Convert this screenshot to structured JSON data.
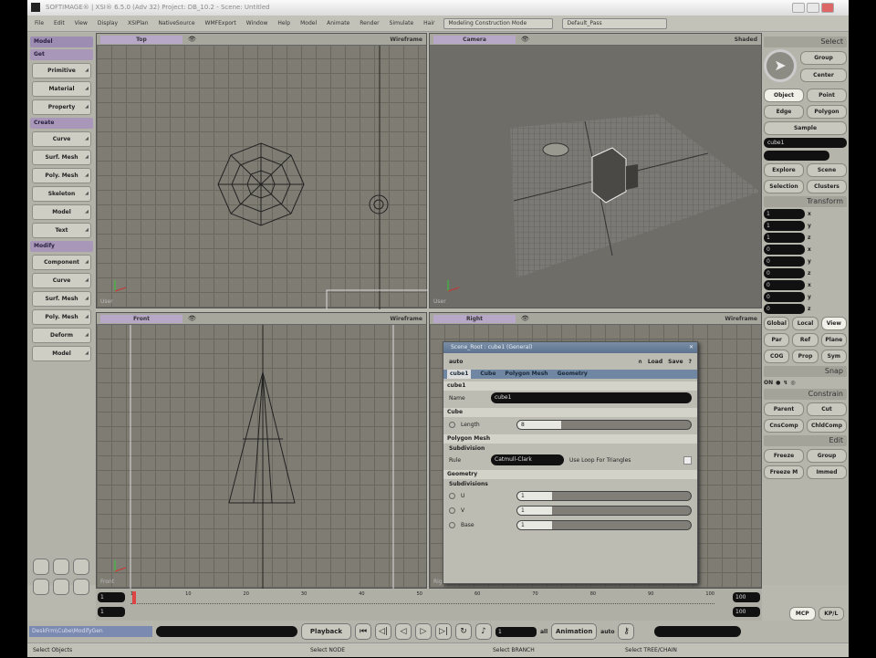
{
  "window": {
    "title": "SOFTIMAGE® | XSI® 6.5.0 (Adv 32) Project: DB_10.2 - Scene: Untitled"
  },
  "menu": [
    "File",
    "Edit",
    "View",
    "Display",
    "XSIPlan",
    "NativeSource",
    "WMFExport",
    "Window",
    "Help",
    "Model",
    "Animate",
    "Render",
    "Simulate",
    "Hair"
  ],
  "toolbar": {
    "mode": "Modeling Construction Mode",
    "pass": "Default_Pass"
  },
  "left_panel": {
    "selector": "Model",
    "sections": [
      {
        "title": "Get",
        "items": [
          "Primitive",
          "Material",
          "Property"
        ]
      },
      {
        "title": "Create",
        "items": [
          "Curve",
          "Surf. Mesh",
          "Poly. Mesh",
          "Skeleton",
          "Model",
          "Text"
        ]
      },
      {
        "title": "Modify",
        "items": [
          "Component",
          "Curve",
          "Surf. Mesh",
          "Poly. Mesh",
          "Deform",
          "Model"
        ]
      }
    ]
  },
  "viewports": [
    {
      "camera": "Top",
      "mode": "Wireframe",
      "corner": "User"
    },
    {
      "camera": "Camera",
      "mode": "Shaded",
      "corner": "User"
    },
    {
      "camera": "Front",
      "mode": "Wireframe",
      "corner": "Front"
    },
    {
      "camera": "Right",
      "mode": "Wireframe",
      "corner": "Right"
    }
  ],
  "right_panel": {
    "select_title": "Select",
    "select_buttons": [
      "Group",
      "Center"
    ],
    "filter_buttons": [
      [
        "Object",
        "Point"
      ],
      [
        "Edge",
        "Polygon"
      ]
    ],
    "sample": "Sample",
    "name_field": "cube1",
    "explore_buttons": [
      [
        "Explore",
        "Scene"
      ],
      [
        "Selection",
        "Clusters"
      ]
    ],
    "transform_title": "Transform",
    "transform_rows": [
      {
        "axis": "x",
        "value": "1"
      },
      {
        "axis": "y",
        "value": "1"
      },
      {
        "axis": "z",
        "value": "1"
      },
      {
        "axis": "x",
        "value": "0"
      },
      {
        "axis": "y",
        "value": "0"
      },
      {
        "axis": "z",
        "value": "0"
      },
      {
        "axis": "x",
        "value": "0"
      },
      {
        "axis": "y",
        "value": "0"
      },
      {
        "axis": "z",
        "value": "0"
      }
    ],
    "ref_buttons": [
      "Global",
      "Local",
      "View"
    ],
    "ref_buttons2": [
      "Par",
      "Ref",
      "Plane"
    ],
    "ref_buttons3": [
      "COG",
      "Prop",
      "Sym"
    ],
    "snap_title": "Snap",
    "snap_on": "ON",
    "constrain_title": "Constrain",
    "constrain_buttons": [
      [
        "Parent",
        "Cut"
      ],
      [
        "CnsComp",
        "ChldComp"
      ]
    ],
    "edit_title": "Edit",
    "edit_buttons": [
      [
        "Freeze",
        "Group"
      ],
      [
        "Freeze M",
        "Immed"
      ]
    ],
    "bottom_buttons": [
      "MCP",
      "KP/L"
    ]
  },
  "ppg": {
    "title": "Scene_Root : cube1 (General)",
    "tool_left": "auto",
    "load": "Load",
    "save": "Save",
    "help": "?",
    "tabs": [
      "cube1",
      "Cube",
      "Polygon Mesh",
      "Geometry"
    ],
    "sec_cube1": "cube1",
    "name_label": "Name",
    "name_value": "cube1",
    "sec_cube": "Cube",
    "length_label": "Length",
    "length_value": "8",
    "length_fraction": 0.25,
    "sec_poly": "Polygon Mesh",
    "subdiv_label": "Subdivision",
    "rule_label": "Rule",
    "rule_value": "Catmull-Clark",
    "loop_label": "Use Loop For Triangles",
    "sec_geo": "Geometry",
    "geo_subdiv": "Subdivisions",
    "geo_rows": [
      {
        "label": "U",
        "value": "1",
        "fraction": 0.2
      },
      {
        "label": "V",
        "value": "1",
        "fraction": 0.2
      },
      {
        "label": "Base",
        "value": "1",
        "fraction": 0.2
      }
    ]
  },
  "timeline": {
    "start": "1",
    "end": "1",
    "ticks": [
      "1",
      "10",
      "20",
      "30",
      "40",
      "50",
      "60",
      "70",
      "80",
      "90",
      "100"
    ],
    "range_end": "100",
    "range_end2": "100",
    "current": "100"
  },
  "bottom": {
    "command_path": "DeskFrm\\Cube\\ModifyGen",
    "playback": "Playback",
    "frame": "1",
    "all": "all",
    "animation": "Animation",
    "auto": "auto"
  },
  "status": {
    "left": "Select Objects",
    "m1": "Select NODE",
    "m2": "Select BRANCH",
    "m3": "Select TREE/CHAIN"
  }
}
